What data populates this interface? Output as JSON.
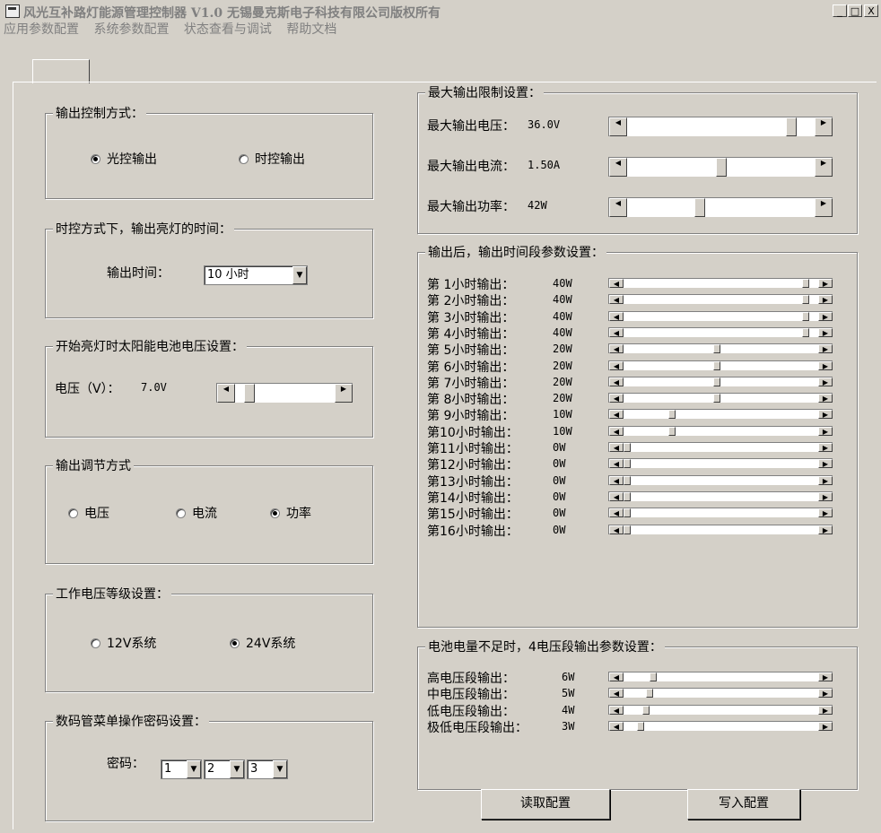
{
  "window": {
    "title": "风光互补路灯能源管理控制器 V1.0   无锡曼克斯电子科技有限公司版权所有",
    "minimize": "_",
    "maximize": "□",
    "close": "X"
  },
  "menu": [
    "应用参数配置",
    "系统参数配置",
    "状态查看与调试",
    "帮助文档"
  ],
  "output_control": {
    "title": "输出控制方式：",
    "options": [
      "光控输出",
      "时控输出"
    ],
    "selected": 0
  },
  "output_time": {
    "title": "时控方式下，输出亮灯的时间：",
    "label": "输出时间：",
    "value": "10 小时"
  },
  "start_voltage": {
    "title": "开始亮灯时太阳能电池电压设置：",
    "label": "电压（V）：",
    "value": "7.0V",
    "level": 0.1
  },
  "regulation": {
    "title": "输出调节方式",
    "options": [
      "电压",
      "电流",
      "功率"
    ],
    "selected": 2
  },
  "voltage_level": {
    "title": "工作电压等级设置：",
    "options": [
      "12V系统",
      "24V系统"
    ],
    "selected": 1
  },
  "password": {
    "title": "数码管菜单操作密码设置：",
    "label": "密码：",
    "digits": [
      "1",
      "2",
      "3"
    ]
  },
  "max_limits": {
    "title": "最大输出限制设置：",
    "rows": [
      {
        "label": "最大输出电压：",
        "value": "36.0V",
        "level": 0.9
      },
      {
        "label": "最大输出电流：",
        "value": "1.50A",
        "level": 0.5
      },
      {
        "label": "最大输出功率：",
        "value": "42W",
        "level": 0.38
      }
    ]
  },
  "hourly": {
    "title": "输出后，输出时间段参数设置：",
    "rows": [
      {
        "label": "第 1小时输出：",
        "value": "40W",
        "level": 0.95
      },
      {
        "label": "第 2小时输出：",
        "value": "40W",
        "level": 0.95
      },
      {
        "label": "第 3小时输出：",
        "value": "40W",
        "level": 0.95
      },
      {
        "label": "第 4小时输出：",
        "value": "40W",
        "level": 0.95
      },
      {
        "label": "第 5小时输出：",
        "value": "20W",
        "level": 0.48
      },
      {
        "label": "第 6小时输出：",
        "value": "20W",
        "level": 0.48
      },
      {
        "label": "第 7小时输出：",
        "value": "20W",
        "level": 0.48
      },
      {
        "label": "第 8小时输出：",
        "value": "20W",
        "level": 0.48
      },
      {
        "label": "第 9小时输出：",
        "value": "10W",
        "level": 0.24
      },
      {
        "label": "第10小时输出：",
        "value": "10W",
        "level": 0.24
      },
      {
        "label": "第11小时输出：",
        "value": "0W",
        "level": 0
      },
      {
        "label": "第12小时输出：",
        "value": "0W",
        "level": 0
      },
      {
        "label": "第13小时输出：",
        "value": "0W",
        "level": 0
      },
      {
        "label": "第14小时输出：",
        "value": "0W",
        "level": 0
      },
      {
        "label": "第15小时输出：",
        "value": "0W",
        "level": 0
      },
      {
        "label": "第16小时输出：",
        "value": "0W",
        "level": 0
      }
    ]
  },
  "battery": {
    "title": "电池电量不足时，4电压段输出参数设置：",
    "rows": [
      {
        "label": "高电压段输出：",
        "value": "6W",
        "level": 0.14
      },
      {
        "label": "中电压段输出：",
        "value": "5W",
        "level": 0.12
      },
      {
        "label": "低电压段输出：",
        "value": "4W",
        "level": 0.1
      },
      {
        "label": "极低电压段输出：",
        "value": "3W",
        "level": 0.07
      }
    ]
  },
  "buttons": {
    "read": "读取配置",
    "write": "写入配置"
  }
}
